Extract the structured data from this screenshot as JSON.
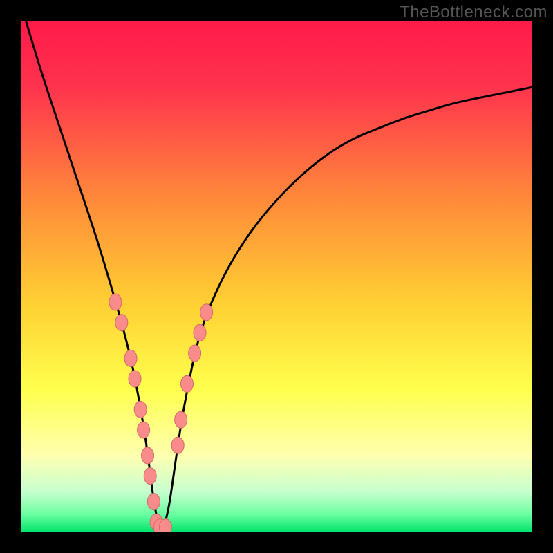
{
  "watermark": "TheBottleneck.com",
  "colors": {
    "red": "#ff1a4a",
    "orange": "#ffa726",
    "yellow": "#ffff4d",
    "pale_yellow": "#ffffb0",
    "green_light": "#9bffb0",
    "green": "#00e36b",
    "curve": "#000000",
    "marker_fill": "#f98b8b",
    "marker_stroke": "#d36b6b",
    "frame": "#000000"
  },
  "chart_data": {
    "type": "line",
    "title": "",
    "xlabel": "",
    "ylabel": "",
    "xlim": [
      0,
      100
    ],
    "ylim": [
      0,
      100
    ],
    "legend": false,
    "grid": false,
    "description": "Bottleneck-style V curve: steep left descent, minimum near x≈27, right branch asymptotically rising.",
    "series": [
      {
        "name": "curve",
        "x": [
          1,
          4,
          8,
          12,
          15,
          18,
          20,
          22,
          24,
          25,
          26,
          27,
          28,
          29,
          30,
          31,
          32,
          34,
          36,
          40,
          45,
          50,
          55,
          60,
          65,
          70,
          75,
          80,
          85,
          90,
          95,
          100
        ],
        "y": [
          100,
          90,
          78,
          66,
          57,
          47,
          40,
          32,
          21,
          14,
          6,
          1,
          1,
          5,
          12,
          19,
          25,
          35,
          42,
          51,
          59,
          65,
          70,
          74,
          77,
          79,
          81,
          82.5,
          84,
          85,
          86,
          87
        ]
      }
    ],
    "markers": [
      {
        "x": 18.5,
        "y": 45
      },
      {
        "x": 19.7,
        "y": 41
      },
      {
        "x": 21.5,
        "y": 34
      },
      {
        "x": 22.3,
        "y": 30
      },
      {
        "x": 23.4,
        "y": 24
      },
      {
        "x": 24.0,
        "y": 20
      },
      {
        "x": 24.8,
        "y": 15
      },
      {
        "x": 25.3,
        "y": 11
      },
      {
        "x": 26.0,
        "y": 6
      },
      {
        "x": 26.5,
        "y": 2
      },
      {
        "x": 27.2,
        "y": 1
      },
      {
        "x": 28.3,
        "y": 1
      },
      {
        "x": 30.7,
        "y": 17
      },
      {
        "x": 31.3,
        "y": 22
      },
      {
        "x": 32.5,
        "y": 29
      },
      {
        "x": 34.0,
        "y": 35
      },
      {
        "x": 35.0,
        "y": 39
      },
      {
        "x": 36.3,
        "y": 43
      }
    ],
    "gradient_stops": [
      {
        "offset": 0.0,
        "color": "#ff1a4a"
      },
      {
        "offset": 0.13,
        "color": "#ff334d"
      },
      {
        "offset": 0.35,
        "color": "#ff8a3a"
      },
      {
        "offset": 0.55,
        "color": "#ffcf33"
      },
      {
        "offset": 0.72,
        "color": "#ffff4d"
      },
      {
        "offset": 0.85,
        "color": "#ffffb0"
      },
      {
        "offset": 0.92,
        "color": "#c8ffcf"
      },
      {
        "offset": 0.965,
        "color": "#6bffa0"
      },
      {
        "offset": 1.0,
        "color": "#00e36b"
      }
    ]
  }
}
